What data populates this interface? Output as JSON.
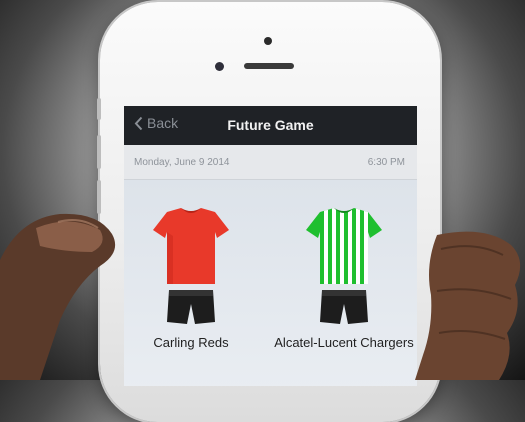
{
  "nav": {
    "back_label": "Back",
    "title": "Future Game"
  },
  "game": {
    "date": "Monday, June 9 2014",
    "time": "6:30 PM"
  },
  "teams": [
    {
      "name": "Carling Reds",
      "shirt_color": "#e8392a"
    },
    {
      "name": "Alcatel-Lucent Chargers",
      "shirt_color": "#1fbf2f"
    }
  ],
  "colors": {
    "navbar": "#1f2226",
    "phone_body": "#f2f2f2",
    "shorts": "#1d1d1d"
  }
}
